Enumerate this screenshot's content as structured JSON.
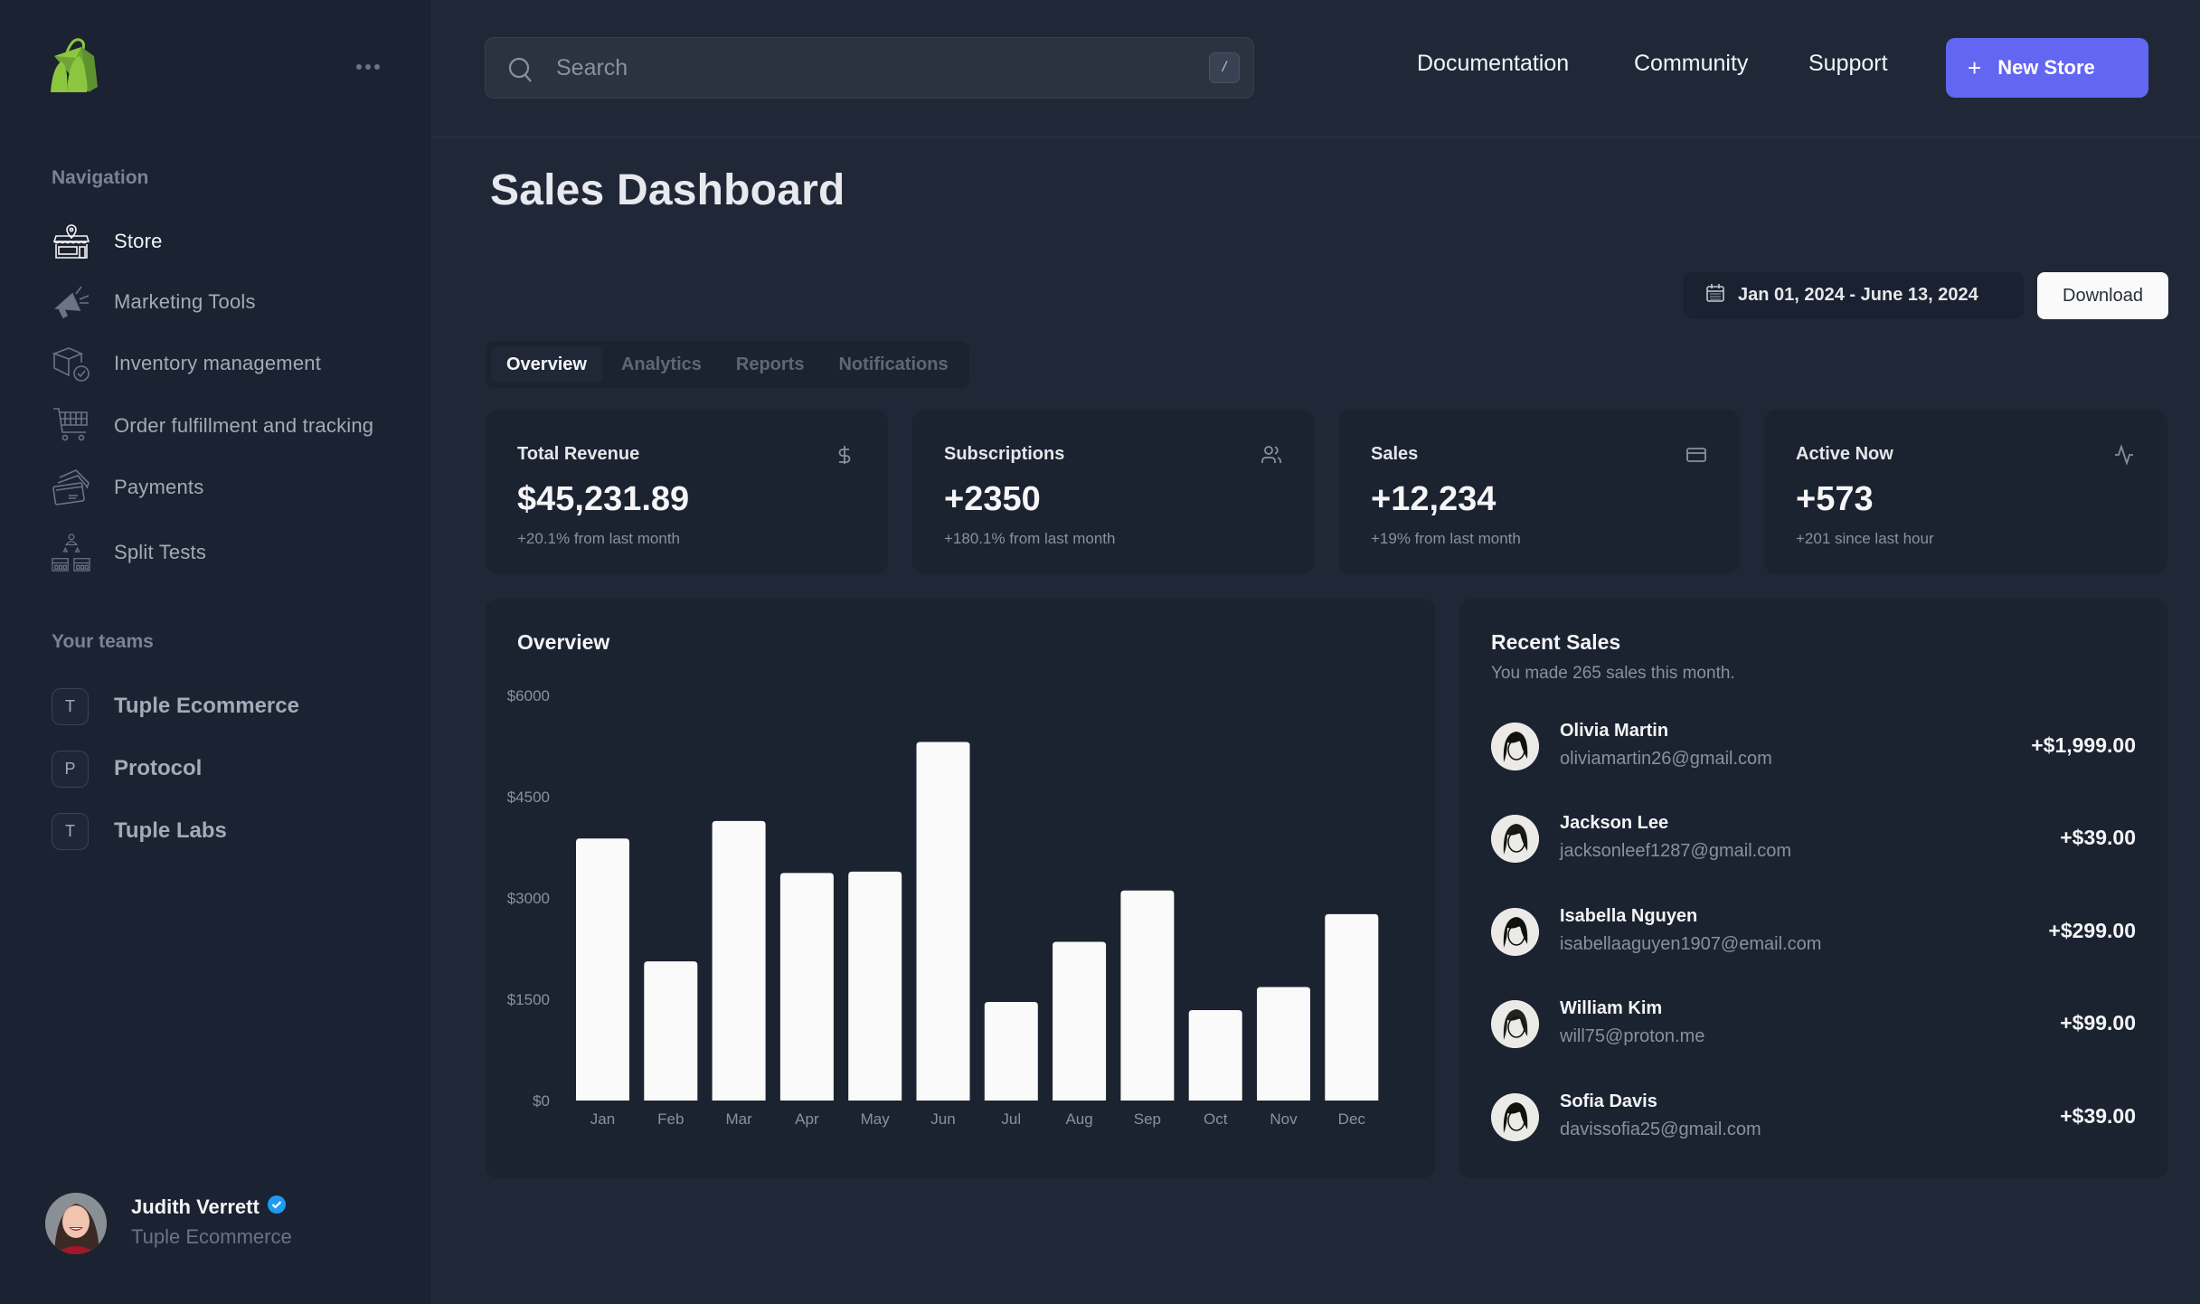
{
  "sidebar": {
    "more_label": "More options",
    "navigation_label": "Navigation",
    "nav_items": [
      {
        "label": "Store",
        "icon": "store-icon",
        "active": true
      },
      {
        "label": "Marketing Tools",
        "icon": "megaphone-icon"
      },
      {
        "label": "Inventory management",
        "icon": "box-check-icon"
      },
      {
        "label": "Order fulfillment and tracking",
        "icon": "cart-icon"
      },
      {
        "label": "Payments",
        "icon": "credit-cards-icon"
      },
      {
        "label": "Split Tests",
        "icon": "ab-test-icon"
      }
    ],
    "teams_label": "Your teams",
    "teams": [
      {
        "initial": "T",
        "label": "Tuple Ecommerce"
      },
      {
        "initial": "P",
        "label": "Protocol"
      },
      {
        "initial": "T",
        "label": "Tuple Labs"
      }
    ],
    "user": {
      "name": "Judith Verrett",
      "verified": true,
      "team": "Tuple Ecommerce"
    }
  },
  "header": {
    "search_placeholder": "Search",
    "search_value": "",
    "search_shortcut": "/",
    "links": [
      "Documentation",
      "Community",
      "Support"
    ],
    "new_store_label": "New Store",
    "brand_color": "#6366f1"
  },
  "page": {
    "title": "Sales Dashboard",
    "date_range": "Jan 01, 2024 - June 13, 2024",
    "download_label": "Download",
    "tabs": [
      {
        "label": "Overview",
        "active": true
      },
      {
        "label": "Analytics"
      },
      {
        "label": "Reports"
      },
      {
        "label": "Notifications"
      }
    ]
  },
  "stats": [
    {
      "title": "Total Revenue",
      "value": "$45,231.89",
      "sub": "+20.1% from last month",
      "icon": "dollar-icon"
    },
    {
      "title": "Subscriptions",
      "value": "+2350",
      "sub": "+180.1% from last month",
      "icon": "users-icon"
    },
    {
      "title": "Sales",
      "value": "+12,234",
      "sub": "+19% from last month",
      "icon": "credit-card-icon"
    },
    {
      "title": "Active Now",
      "value": "+573",
      "sub": "+201 since last hour",
      "icon": "activity-icon"
    }
  ],
  "overview": {
    "title": "Overview"
  },
  "chart_data": {
    "type": "bar",
    "title": "Overview",
    "xlabel": "",
    "ylabel": "",
    "categories": [
      "Jan",
      "Feb",
      "Mar",
      "Apr",
      "May",
      "Jun",
      "Jul",
      "Aug",
      "Sep",
      "Oct",
      "Nov",
      "Dec"
    ],
    "values": [
      3880,
      2060,
      4140,
      3370,
      3390,
      5310,
      1460,
      2350,
      3110,
      1340,
      1680,
      2760
    ],
    "yticks": [
      0,
      1500,
      3000,
      4500,
      6000
    ],
    "ytick_labels": [
      "$0",
      "$1500",
      "$3000",
      "$4500",
      "$6000"
    ],
    "ylim": [
      0,
      6000
    ],
    "grid": false,
    "bar_color": "#fafafa"
  },
  "recent_sales": {
    "title": "Recent Sales",
    "subtitle": "You made 265 sales this month.",
    "items": [
      {
        "name": "Olivia Martin",
        "email": "oliviamartin26@gmail.com",
        "amount": "+$1,999.00"
      },
      {
        "name": "Jackson Lee",
        "email": "jacksonleef1287@gmail.com",
        "amount": "+$39.00"
      },
      {
        "name": "Isabella Nguyen",
        "email": "isabellaaguyen1907@email.com",
        "amount": "+$299.00"
      },
      {
        "name": "William Kim",
        "email": "will75@proton.me",
        "amount": "+$99.00"
      },
      {
        "name": "Sofia Davis",
        "email": "davissofia25@gmail.com",
        "amount": "+$39.00"
      }
    ]
  }
}
